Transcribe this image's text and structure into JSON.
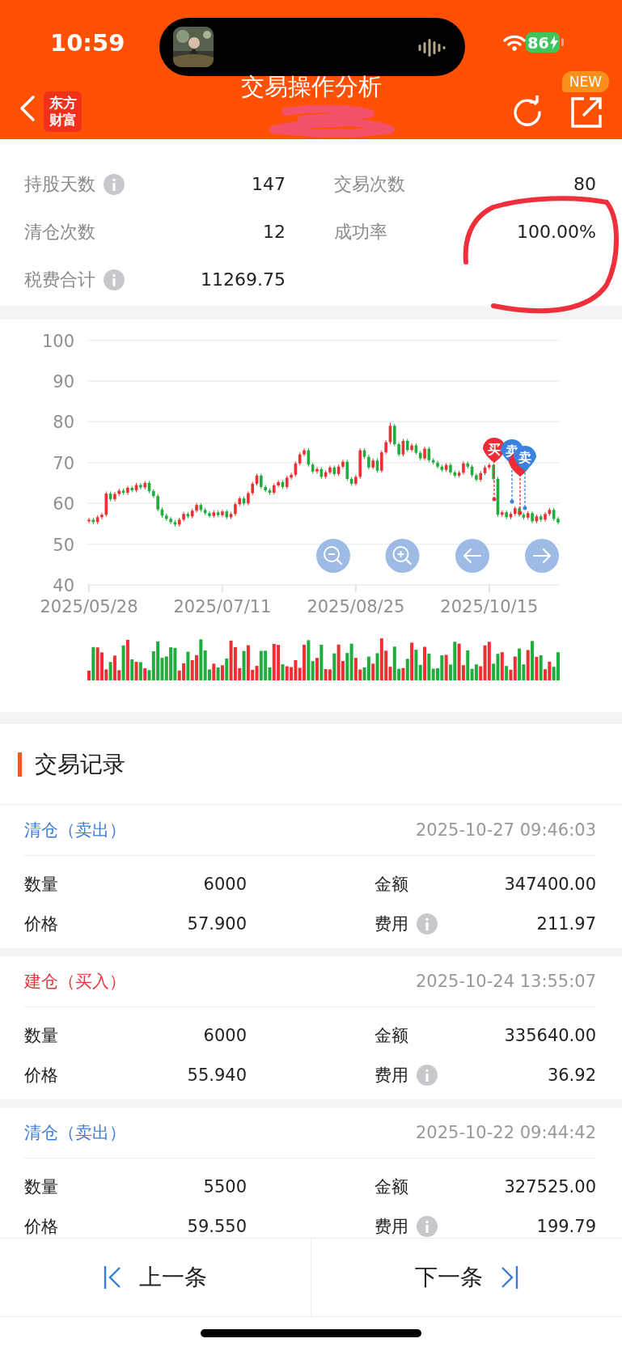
{
  "status_bar": {
    "time": "10:59",
    "battery": "86"
  },
  "header": {
    "logo": [
      "东方",
      "财富"
    ],
    "title": "交易操作分析",
    "badge": "NEW"
  },
  "stats": [
    {
      "label": "持股天数",
      "info": true,
      "value": "147"
    },
    {
      "label": "交易次数",
      "info": false,
      "value": "80"
    },
    {
      "label": "清仓次数",
      "info": false,
      "value": "12"
    },
    {
      "label": "成功率",
      "info": false,
      "value": "100.00%"
    },
    {
      "label": "税费合计",
      "info": true,
      "value": "11269.75"
    }
  ],
  "chart": {
    "chart_data": {
      "type": "candlestick",
      "categories": [
        "2025/05/28",
        null,
        null,
        null,
        null,
        null,
        null,
        null,
        null,
        null,
        null,
        null,
        null,
        null,
        null,
        null,
        null,
        null,
        null,
        null,
        null,
        null,
        null,
        null,
        null,
        null,
        null,
        null,
        null,
        null,
        null,
        "2025/07/11",
        null,
        null,
        null,
        null,
        null,
        null,
        null,
        null,
        null,
        null,
        null,
        null,
        null,
        null,
        null,
        null,
        null,
        null,
        null,
        null,
        null,
        null,
        null,
        null,
        null,
        null,
        null,
        null,
        null,
        null,
        "2025/08/25",
        null,
        null,
        null,
        null,
        null,
        null,
        null,
        null,
        null,
        null,
        null,
        null,
        null,
        null,
        null,
        null,
        null,
        null,
        null,
        null,
        null,
        null,
        null,
        null,
        null,
        null,
        null,
        null,
        null,
        null,
        "2025/10/15",
        null,
        null,
        null,
        null,
        null,
        null,
        null,
        null,
        null,
        null,
        null,
        null,
        null,
        null,
        null,
        null
      ],
      "ohlc": [
        [
          55.6,
          56.5,
          55.1,
          56.0
        ],
        [
          56.0,
          56.5,
          54.9,
          55.4
        ],
        [
          55.4,
          57.1,
          54.9,
          56.6
        ],
        [
          56.6,
          57.7,
          56.1,
          57.2
        ],
        [
          57.2,
          62.9,
          56.7,
          62.4
        ],
        [
          62.4,
          62.9,
          60.5,
          61.0
        ],
        [
          61.0,
          62.8,
          60.5,
          62.3
        ],
        [
          62.3,
          63.6,
          61.8,
          63.1
        ],
        [
          63.1,
          63.6,
          62.1,
          62.6
        ],
        [
          62.6,
          64.3,
          62.1,
          63.8
        ],
        [
          63.8,
          64.3,
          62.7,
          63.2
        ],
        [
          63.2,
          65.0,
          62.7,
          64.5
        ],
        [
          64.5,
          65.0,
          63.4,
          63.9
        ],
        [
          63.9,
          65.5,
          63.4,
          65.0
        ],
        [
          65.0,
          65.5,
          62.5,
          63.0
        ],
        [
          63.0,
          63.5,
          61.3,
          61.8
        ],
        [
          61.8,
          62.3,
          58.0,
          58.5
        ],
        [
          58.5,
          59.0,
          56.5,
          57.0
        ],
        [
          57.0,
          57.5,
          55.7,
          56.2
        ],
        [
          56.2,
          56.7,
          54.9,
          55.4
        ],
        [
          55.4,
          55.9,
          54.3,
          54.8
        ],
        [
          54.8,
          56.5,
          54.3,
          56.0
        ],
        [
          56.0,
          57.9,
          55.5,
          57.4
        ],
        [
          57.4,
          57.9,
          56.3,
          56.8
        ],
        [
          56.8,
          58.7,
          56.3,
          58.2
        ],
        [
          58.2,
          60.1,
          57.7,
          59.6
        ],
        [
          59.6,
          60.1,
          57.9,
          58.4
        ],
        [
          58.4,
          58.9,
          57.1,
          57.6
        ],
        [
          57.6,
          58.1,
          56.4,
          56.9
        ],
        [
          56.9,
          58.3,
          56.4,
          57.8
        ],
        [
          57.8,
          58.3,
          56.6,
          57.1
        ],
        [
          57.1,
          58.5,
          56.6,
          58.0
        ],
        [
          58.0,
          58.5,
          56.1,
          56.6
        ],
        [
          56.6,
          57.9,
          56.1,
          57.4
        ],
        [
          57.4,
          60.3,
          56.9,
          59.8
        ],
        [
          59.8,
          61.7,
          59.3,
          61.2
        ],
        [
          61.2,
          61.7,
          59.5,
          60.0
        ],
        [
          60.0,
          63.0,
          59.5,
          62.5
        ],
        [
          62.5,
          65.3,
          62.0,
          64.8
        ],
        [
          64.8,
          67.3,
          64.3,
          66.8
        ],
        [
          66.8,
          67.3,
          63.5,
          64.0
        ],
        [
          64.0,
          64.5,
          62.7,
          63.2
        ],
        [
          63.2,
          63.7,
          62.1,
          62.6
        ],
        [
          62.6,
          64.9,
          62.1,
          64.4
        ],
        [
          64.4,
          65.7,
          63.9,
          65.2
        ],
        [
          65.2,
          65.7,
          63.5,
          64.0
        ],
        [
          64.0,
          66.8,
          63.5,
          66.3
        ],
        [
          66.3,
          67.5,
          65.8,
          67.0
        ],
        [
          67.0,
          70.3,
          66.5,
          69.8
        ],
        [
          69.8,
          72.5,
          69.3,
          72.0
        ],
        [
          72.0,
          73.5,
          71.5,
          73.0
        ],
        [
          73.0,
          73.5,
          69.0,
          69.5
        ],
        [
          69.5,
          70.0,
          67.3,
          67.8
        ],
        [
          67.8,
          68.9,
          67.3,
          68.4
        ],
        [
          68.4,
          68.9,
          66.0,
          66.5
        ],
        [
          66.5,
          68.1,
          66.0,
          67.6
        ],
        [
          67.6,
          69.3,
          67.1,
          68.8
        ],
        [
          68.8,
          69.3,
          66.7,
          67.2
        ],
        [
          67.2,
          69.5,
          66.7,
          69.0
        ],
        [
          69.0,
          70.7,
          68.5,
          70.2
        ],
        [
          70.2,
          70.7,
          65.5,
          66.0
        ],
        [
          66.0,
          66.5,
          64.3,
          64.8
        ],
        [
          64.8,
          67.0,
          64.3,
          66.5
        ],
        [
          66.5,
          73.5,
          66.0,
          73.0
        ],
        [
          73.0,
          73.5,
          70.9,
          71.4
        ],
        [
          71.4,
          71.9,
          68.3,
          68.8
        ],
        [
          68.8,
          71.0,
          68.3,
          70.5
        ],
        [
          70.5,
          71.0,
          67.5,
          68.0
        ],
        [
          68.0,
          73.0,
          67.5,
          72.5
        ],
        [
          72.5,
          75.5,
          72.0,
          75.0
        ],
        [
          75.0,
          79.8,
          74.5,
          79.0
        ],
        [
          79.0,
          79.5,
          74.0,
          74.5
        ],
        [
          74.5,
          75.0,
          71.5,
          72.0
        ],
        [
          72.0,
          75.8,
          71.5,
          75.3
        ],
        [
          75.3,
          75.8,
          72.6,
          73.1
        ],
        [
          73.1,
          74.7,
          72.6,
          74.2
        ],
        [
          74.2,
          74.7,
          71.9,
          72.4
        ],
        [
          72.4,
          72.9,
          70.5,
          71.0
        ],
        [
          71.0,
          73.9,
          70.5,
          73.4
        ],
        [
          73.4,
          73.9,
          70.1,
          70.6
        ],
        [
          70.6,
          71.1,
          69.5,
          70.0
        ],
        [
          70.0,
          70.5,
          68.5,
          69.0
        ],
        [
          69.0,
          69.5,
          67.7,
          68.2
        ],
        [
          68.2,
          69.9,
          67.7,
          69.4
        ],
        [
          69.4,
          69.9,
          67.1,
          67.6
        ],
        [
          67.6,
          68.1,
          66.3,
          66.8
        ],
        [
          66.8,
          68.0,
          66.3,
          67.5
        ],
        [
          67.5,
          70.3,
          67.0,
          69.8
        ],
        [
          69.8,
          70.3,
          68.5,
          69.0
        ],
        [
          69.0,
          69.5,
          66.4,
          66.9
        ],
        [
          66.9,
          67.4,
          65.3,
          65.8
        ],
        [
          65.8,
          67.9,
          65.3,
          67.4
        ],
        [
          67.4,
          69.3,
          66.9,
          68.8
        ],
        [
          68.8,
          69.8,
          68.3,
          69.4
        ],
        [
          69.4,
          69.8,
          65.5,
          66.0
        ],
        [
          66.0,
          66.5,
          56.7,
          57.2
        ],
        [
          57.2,
          58.3,
          56.7,
          57.8
        ],
        [
          57.8,
          58.3,
          56.1,
          56.6
        ],
        [
          56.6,
          57.9,
          56.1,
          57.4
        ],
        [
          57.4,
          59.3,
          56.9,
          58.8
        ],
        [
          58.8,
          59.3,
          56.7,
          57.2
        ],
        [
          57.2,
          57.7,
          56.0,
          56.5
        ],
        [
          56.5,
          58.1,
          56.0,
          57.6
        ],
        [
          57.6,
          58.1,
          55.1,
          55.6
        ],
        [
          55.6,
          57.3,
          55.1,
          56.8
        ],
        [
          56.8,
          57.3,
          55.5,
          56.0
        ],
        [
          56.0,
          57.9,
          55.5,
          57.4
        ],
        [
          57.4,
          58.9,
          56.9,
          58.4
        ],
        [
          58.4,
          58.9,
          55.7,
          56.2
        ],
        [
          56.2,
          56.7,
          54.8,
          55.3
        ]
      ],
      "ylim": [
        40,
        100
      ],
      "grid": true,
      "yticks": [
        40,
        50,
        60,
        70,
        80,
        90,
        100
      ]
    },
    "markers": [
      {
        "kind": "buy",
        "label": "买"
      },
      {
        "kind": "sell",
        "label": "卖"
      },
      {
        "kind": "buy"
      },
      {
        "kind": "sell",
        "label": "卖"
      }
    ]
  },
  "section_title": "交易记录",
  "records": [
    {
      "kind": "sell",
      "type": "清仓（卖出）",
      "time": "2025-10-27 09:46:03",
      "fields": [
        {
          "label": "数量",
          "value": "6000",
          "info": false
        },
        {
          "label": "金额",
          "value": "347400.00",
          "info": false
        },
        {
          "label": "价格",
          "value": "57.900",
          "info": false
        },
        {
          "label": "费用",
          "value": "211.97",
          "info": true
        }
      ]
    },
    {
      "kind": "buy",
      "type": "建仓（买入）",
      "time": "2025-10-24 13:55:07",
      "fields": [
        {
          "label": "数量",
          "value": "6000",
          "info": false
        },
        {
          "label": "金额",
          "value": "335640.00",
          "info": false
        },
        {
          "label": "价格",
          "value": "55.940",
          "info": false
        },
        {
          "label": "费用",
          "value": "36.92",
          "info": true
        }
      ]
    },
    {
      "kind": "sell",
      "type": "清仓（卖出）",
      "time": "2025-10-22 09:44:42",
      "fields": [
        {
          "label": "数量",
          "value": "5500",
          "info": false
        },
        {
          "label": "金额",
          "value": "327525.00",
          "info": false
        },
        {
          "label": "价格",
          "value": "59.550",
          "info": false
        },
        {
          "label": "费用",
          "value": "199.79",
          "info": true
        }
      ]
    }
  ],
  "footer": {
    "prev": "上一条",
    "next": "下一条"
  }
}
